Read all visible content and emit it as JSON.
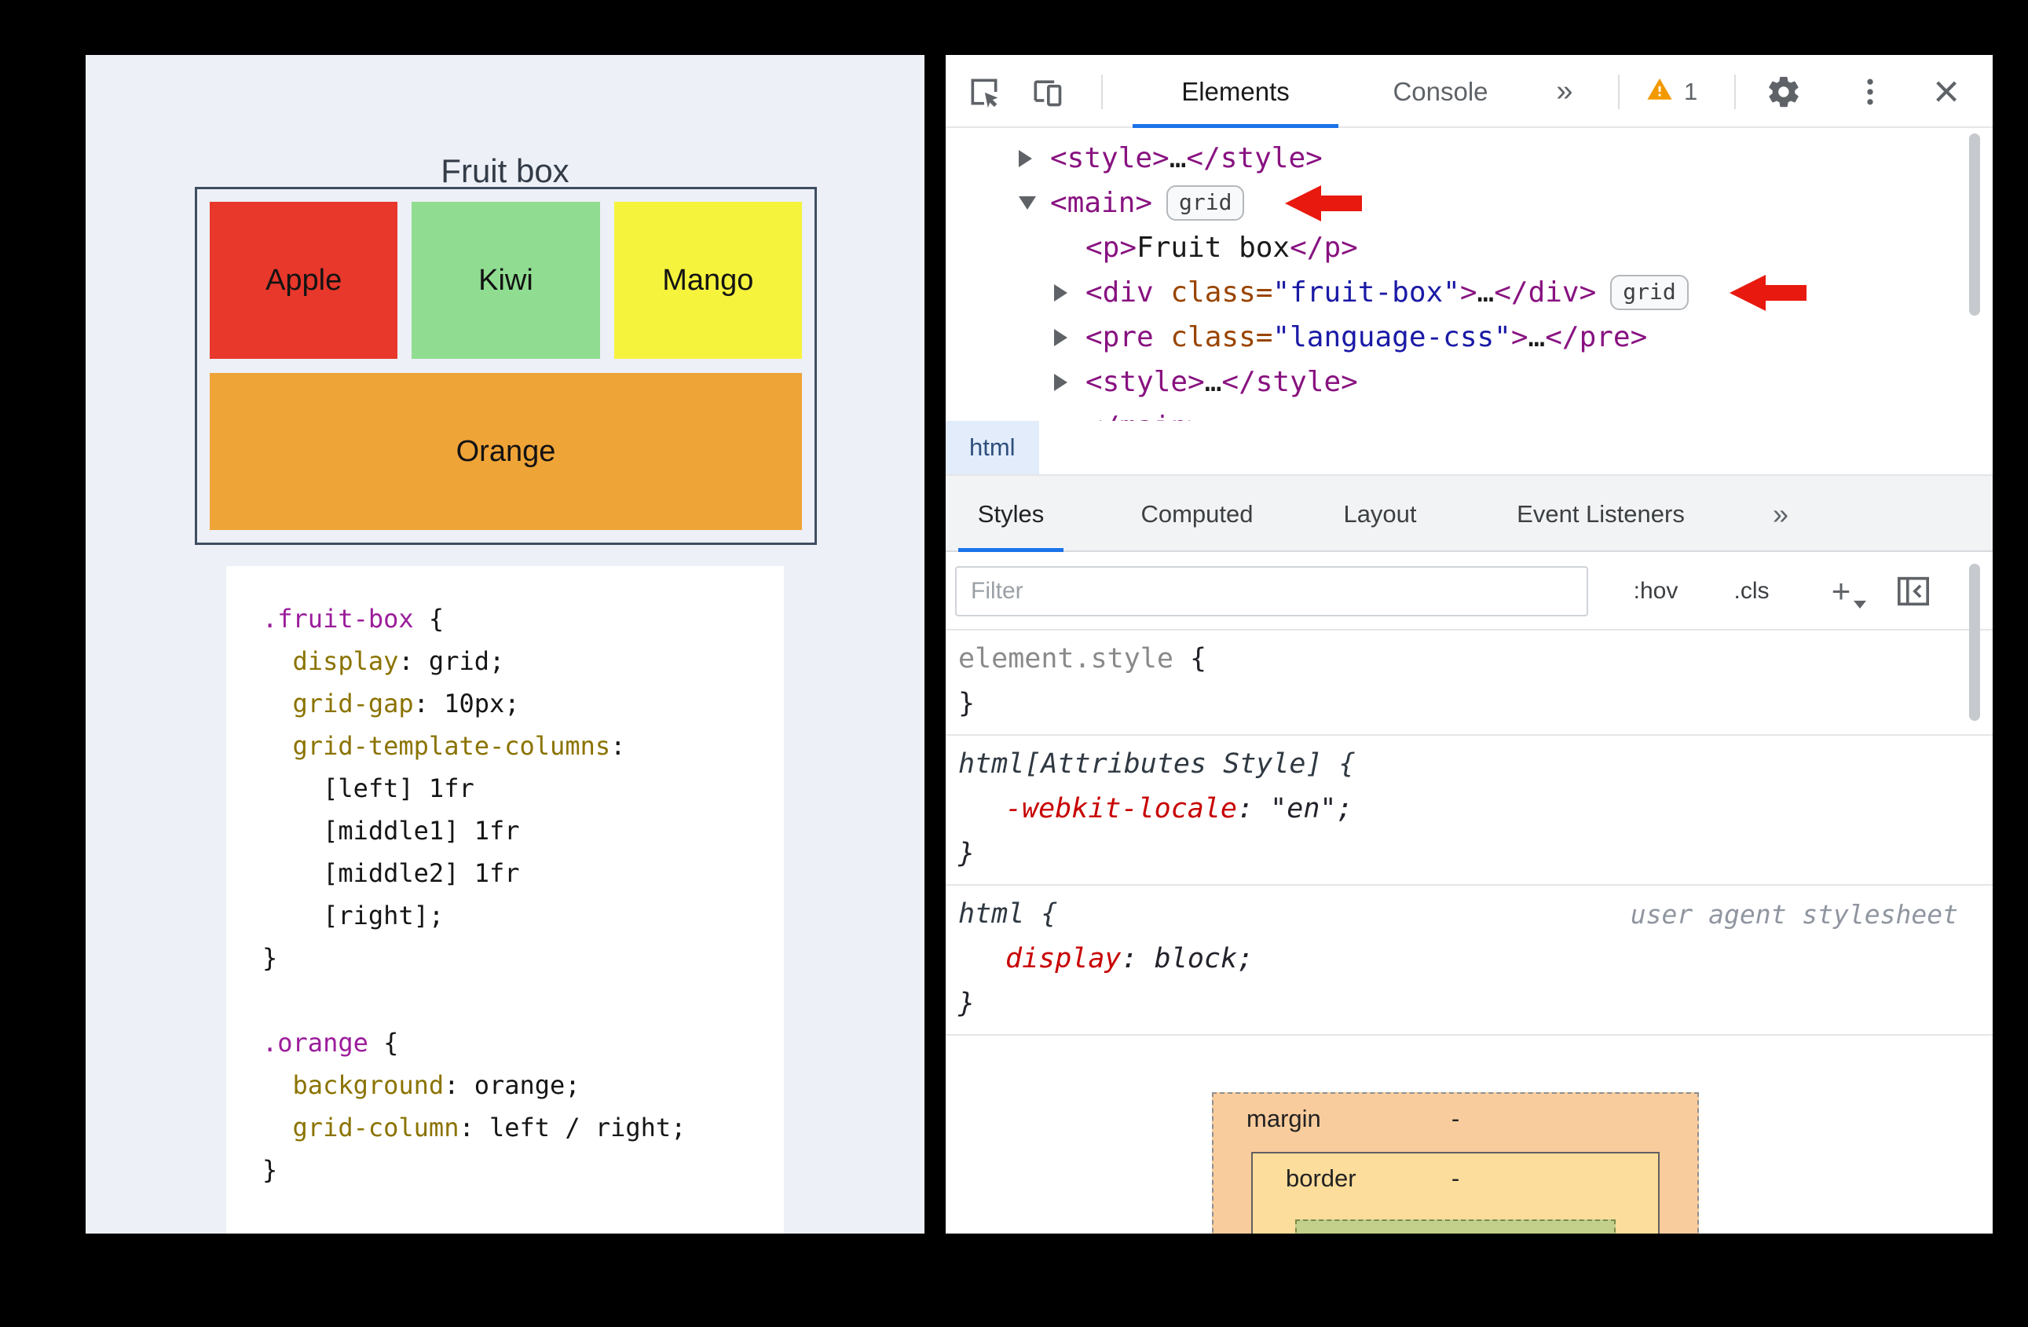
{
  "preview": {
    "title": "Fruit box",
    "fruits": [
      {
        "label": "Apple",
        "color": "#e8372b"
      },
      {
        "label": "Kiwi",
        "color": "#90dd91"
      },
      {
        "label": "Mango",
        "color": "#f6f33d"
      }
    ],
    "full_width_fruit": {
      "label": "Orange",
      "color": "#efa437"
    },
    "code": {
      "lines": [
        {
          "tokens": [
            [
              "sel",
              ".fruit-box"
            ],
            [
              "pln",
              " {"
            ]
          ]
        },
        {
          "tokens": [
            [
              "pln",
              "  "
            ],
            [
              "prp",
              "display"
            ],
            [
              "pln",
              ": grid;"
            ]
          ]
        },
        {
          "tokens": [
            [
              "pln",
              "  "
            ],
            [
              "prp",
              "grid-gap"
            ],
            [
              "pln",
              ": 10px;"
            ]
          ]
        },
        {
          "tokens": [
            [
              "pln",
              "  "
            ],
            [
              "prp",
              "grid-template-columns"
            ],
            [
              "pln",
              ":"
            ]
          ]
        },
        {
          "tokens": [
            [
              "pln",
              "    [left] 1fr"
            ]
          ]
        },
        {
          "tokens": [
            [
              "pln",
              "    [middle1] 1fr"
            ]
          ]
        },
        {
          "tokens": [
            [
              "pln",
              "    [middle2] 1fr"
            ]
          ]
        },
        {
          "tokens": [
            [
              "pln",
              "    [right];"
            ]
          ]
        },
        {
          "tokens": [
            [
              "pln",
              "}"
            ]
          ]
        },
        {
          "tokens": []
        },
        {
          "tokens": [
            [
              "sel",
              ".orange"
            ],
            [
              "pln",
              " {"
            ]
          ]
        },
        {
          "tokens": [
            [
              "pln",
              "  "
            ],
            [
              "prp",
              "background"
            ],
            [
              "pln",
              ": orange;"
            ]
          ]
        },
        {
          "tokens": [
            [
              "pln",
              "  "
            ],
            [
              "prp",
              "grid-column"
            ],
            [
              "pln",
              ": left / right;"
            ]
          ]
        },
        {
          "tokens": [
            [
              "pln",
              "}"
            ]
          ]
        }
      ]
    }
  },
  "devtools": {
    "toolbar": {
      "tab_elements": "Elements",
      "tab_console": "Console",
      "more_tabs": "»",
      "warning_count": "1",
      "close_glyph": "×"
    },
    "icons": {
      "inspect": "cursor-in-box",
      "device_toolbar": "phone-and-tablet",
      "warning": "orange-triangle-exclamation",
      "settings": "gear",
      "menu": "kebab-three-dots",
      "sidebar_toggle": "panel-with-left-arrow",
      "disclosure_closed": "right-triangle",
      "disclosure_open": "down-triangle",
      "annotation": "red-left-arrow"
    },
    "dom_tree": {
      "rows": [
        {
          "level": 1,
          "arrow": "closed",
          "tokens": [
            [
              "tag",
              "<style>"
            ],
            [
              "pln",
              "…"
            ],
            [
              "tag",
              "</style>"
            ]
          ]
        },
        {
          "level": 1,
          "arrow": "open",
          "tokens": [
            [
              "tag",
              "<main>"
            ]
          ],
          "badge": "grid",
          "red_arrow": true
        },
        {
          "level": 2,
          "arrow": null,
          "tokens": [
            [
              "tag",
              "<p>"
            ],
            [
              "pln",
              "Fruit box"
            ],
            [
              "tag",
              "</p>"
            ]
          ]
        },
        {
          "level": 2,
          "arrow": "closed",
          "tokens": [
            [
              "tag",
              "<div"
            ],
            [
              "attr",
              " class="
            ],
            [
              "str",
              "\"fruit-box\""
            ],
            [
              "tag",
              ">"
            ],
            [
              "pln",
              "…"
            ],
            [
              "tag",
              "</div>"
            ]
          ],
          "badge": "grid",
          "red_arrow": true
        },
        {
          "level": 2,
          "arrow": "closed",
          "tokens": [
            [
              "tag",
              "<pre"
            ],
            [
              "attr",
              " class="
            ],
            [
              "str",
              "\"language-css\""
            ],
            [
              "tag",
              ">"
            ],
            [
              "pln",
              "…"
            ],
            [
              "tag",
              "</pre>"
            ]
          ]
        },
        {
          "level": 2,
          "arrow": "closed",
          "tokens": [
            [
              "tag",
              "<style>"
            ],
            [
              "pln",
              "…"
            ],
            [
              "tag",
              "</style>"
            ]
          ]
        },
        {
          "level": 2,
          "arrow": null,
          "tokens": [
            [
              "tag",
              "</main>"
            ]
          ]
        }
      ]
    },
    "breadcrumb": "html",
    "styles_tabs": [
      "Styles",
      "Computed",
      "Layout",
      "Event Listeners",
      "»"
    ],
    "filter": {
      "placeholder": "Filter",
      "hov": ":hov",
      "cls": ".cls",
      "plus": "+"
    },
    "rules": [
      {
        "italic": false,
        "lines": [
          {
            "indent": false,
            "tokens": [
              [
                "gsel",
                "element.style"
              ],
              [
                "pln",
                " {"
              ]
            ]
          },
          {
            "indent": false,
            "tokens": [
              [
                "pln",
                "}"
              ]
            ]
          }
        ]
      },
      {
        "italic": true,
        "lines": [
          {
            "indent": false,
            "tokens": [
              [
                "sel2",
                "html[Attributes Style] {"
              ]
            ]
          },
          {
            "indent": true,
            "tokens": [
              [
                "prp",
                "-webkit-locale"
              ],
              [
                "pln",
                ": "
              ],
              [
                "val",
                "\"en\""
              ],
              [
                "pln",
                ";"
              ]
            ]
          },
          {
            "indent": false,
            "tokens": [
              [
                "pln",
                "}"
              ]
            ]
          }
        ]
      },
      {
        "italic": true,
        "origin": "user agent stylesheet",
        "lines": [
          {
            "indent": false,
            "tokens": [
              [
                "sel2",
                "html {"
              ]
            ]
          },
          {
            "indent": true,
            "tokens": [
              [
                "prp",
                "display"
              ],
              [
                "pln",
                ": "
              ],
              [
                "val",
                "block"
              ],
              [
                "pln",
                ";"
              ]
            ]
          },
          {
            "indent": false,
            "tokens": [
              [
                "pln",
                "}"
              ]
            ]
          }
        ]
      }
    ],
    "box_model": {
      "margin_label": "margin",
      "margin_value": "-",
      "border_label": "border",
      "border_value": "-"
    },
    "accent_colors": {
      "tab_underline": "#1a73e8",
      "annotation_red": "#e8190f",
      "warning_orange": "#f29900"
    }
  }
}
